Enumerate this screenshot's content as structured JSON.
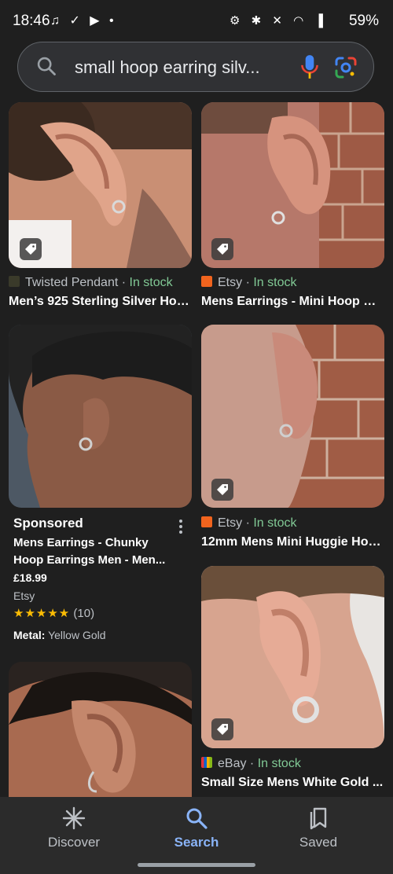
{
  "status_bar": {
    "time": "18:46",
    "left_icons": "♫ ✓ ▶ •",
    "right_icons": "⚙ ✱ ✕ ◠ ▐",
    "battery": "59%"
  },
  "search": {
    "query": "small hoop earring silv..."
  },
  "results": [
    {
      "source": "Twisted Pendant",
      "sep": " · ",
      "stock": "In stock",
      "title": "Men’s 925 Sterling Silver Hoo...",
      "favicon_color": "#3a3a2a"
    },
    {
      "source": "Etsy",
      "sep": " · ",
      "stock": "In stock",
      "title": "Mens Earrings - Mini Hoop Ea...",
      "favicon_color": "#f1641e"
    },
    {
      "source": "Etsy",
      "sep": " · ",
      "stock": "In stock",
      "title": "12mm Mens Mini Huggie Hoo...",
      "favicon_color": "#f1641e"
    },
    {
      "source": "eBay",
      "sep": " · ",
      "stock": "In stock",
      "title": "Small Size Mens White Gold ...",
      "favicon_color": "#e53238"
    }
  ],
  "sponsored": {
    "label": "Sponsored",
    "title": "Mens Earrings - Chunky Hoop Earrings Men - Men...",
    "price": "£18.99",
    "store": "Etsy",
    "stars": "★★★★★",
    "reviews": "(10)",
    "meta_key": "Metal:",
    "meta_value": "Yellow Gold"
  },
  "bottom_nav": [
    {
      "label": "Discover",
      "icon": "asterisk-icon"
    },
    {
      "label": "Search",
      "icon": "search-icon",
      "active": true
    },
    {
      "label": "Saved",
      "icon": "bookmarks-icon"
    }
  ],
  "colors": {
    "background": "#1f1f1f",
    "accent": "#8ab4f8",
    "in_stock": "#81c995",
    "stars": "#fbbc04"
  }
}
